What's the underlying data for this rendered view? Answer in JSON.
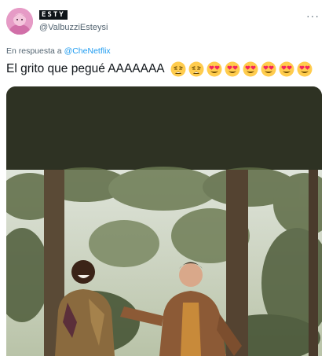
{
  "author": {
    "display_name": "ESTY",
    "handle": "@ValbuzziEsteysi",
    "avatar_icon": "avatar-pink-character"
  },
  "menu": {
    "icon": "more-horizontal-icon",
    "label": "···"
  },
  "reply": {
    "prefix": "En respuesta a",
    "mention": "@CheNetflix"
  },
  "tweet": {
    "text": "El grito que pegué AAAAAAA",
    "emojis": [
      "weary-face",
      "weary-face",
      "heart-eyes",
      "heart-eyes",
      "heart-eyes",
      "heart-eyes",
      "heart-eyes",
      "heart-eyes"
    ]
  },
  "media": {
    "description_icon": "gif-forest-two-people",
    "colors": {
      "band": "#2e3223",
      "sky": "#e9ece4",
      "foliage": "#5d6b45"
    }
  }
}
